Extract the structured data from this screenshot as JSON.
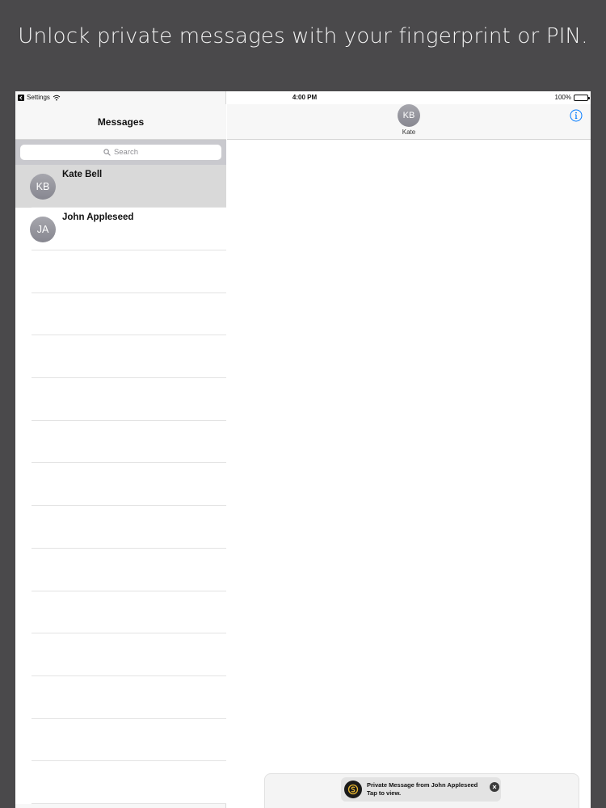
{
  "headline": "Unlock private messages with your fingerprint or PIN.",
  "status_bar": {
    "back_label": "Settings",
    "time": "4:00 PM",
    "battery": "100%"
  },
  "sidebar": {
    "title": "Messages",
    "search_placeholder": "Search",
    "conversations": [
      {
        "initials": "KB",
        "name": "Kate Bell",
        "selected": true
      },
      {
        "initials": "JA",
        "name": "John Appleseed",
        "selected": false
      }
    ]
  },
  "detail": {
    "contact_initials": "KB",
    "contact_name": "Kate"
  },
  "notification": {
    "line1": "Private Message from John Appleseed",
    "line2": "Tap to view."
  },
  "colors": {
    "background": "#4a494b",
    "accent": "#007aff",
    "avatar": "#98989f",
    "selected_row": "#d9d9d9"
  }
}
